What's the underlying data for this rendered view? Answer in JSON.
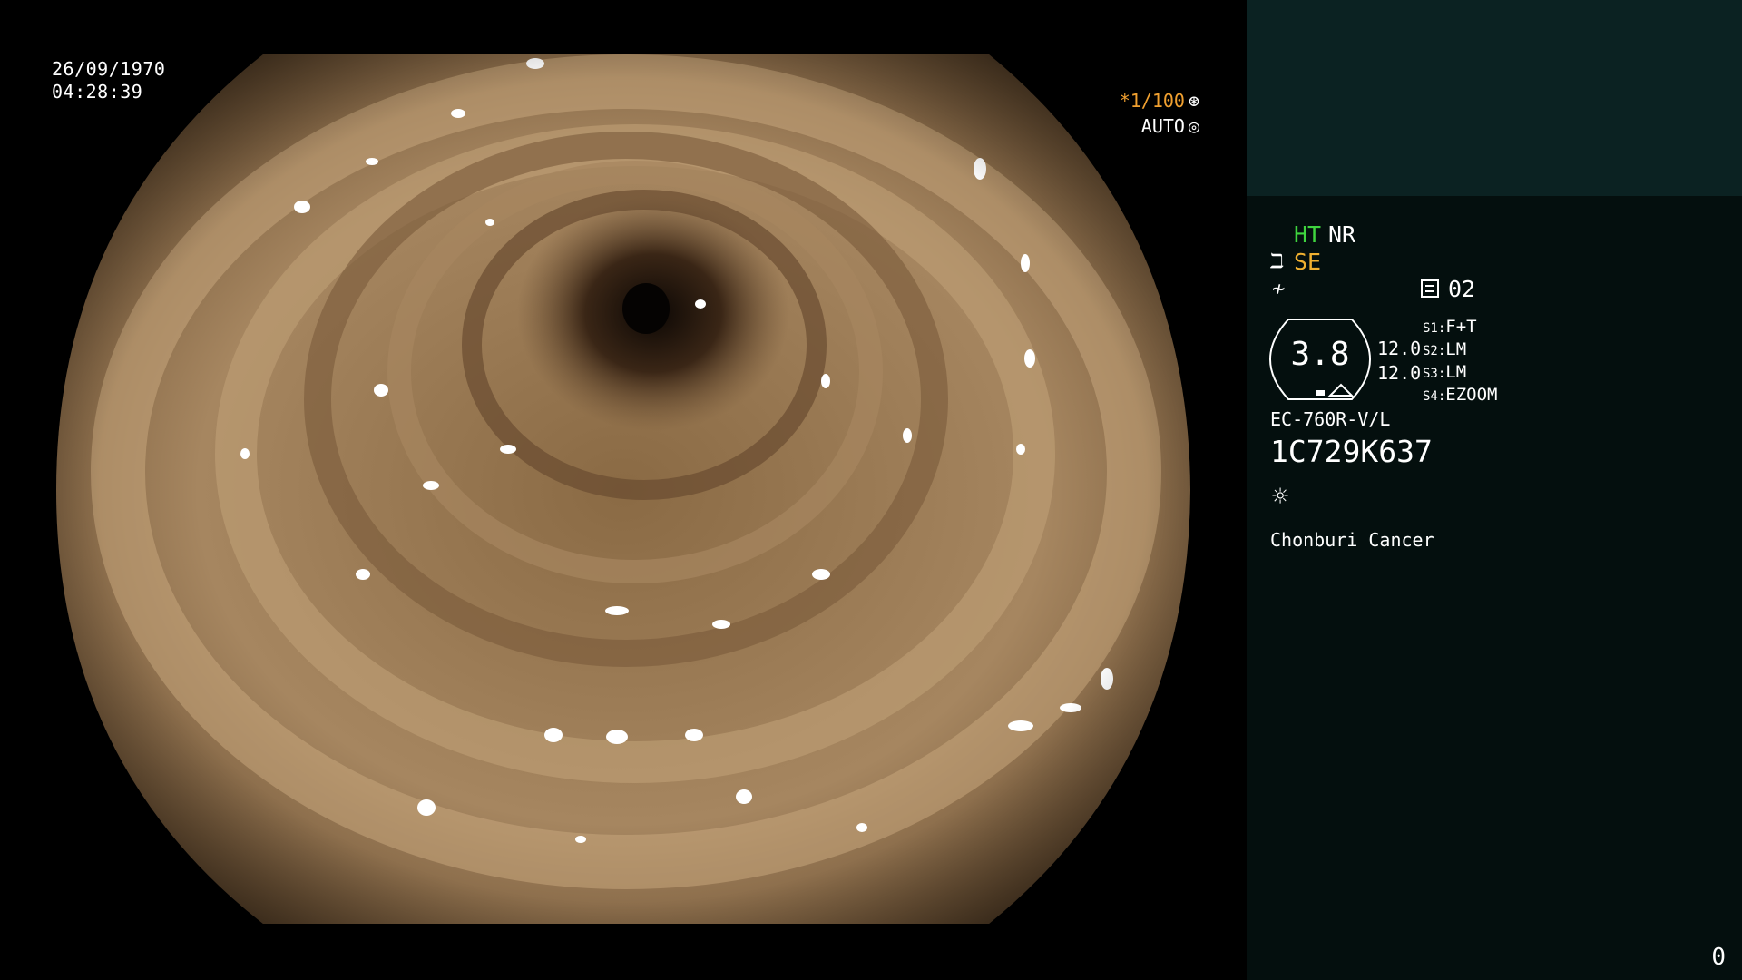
{
  "overlay": {
    "date": "26/09/1970",
    "time": "04:28:39",
    "shutter": "*1/100",
    "shutter_icon": "⊛",
    "iris_mode": "AUTO",
    "iris_icon": "◎"
  },
  "panel": {
    "mode_ht": "HT",
    "mode_nr": "NR",
    "se_icon": "ℶ",
    "mode_se": "SE",
    "wave_icon": "≁",
    "memo_number": "02",
    "zoom_value": "3.8",
    "zoom_values": [
      "12.0",
      "12.0"
    ],
    "switches": [
      {
        "key": "S1:",
        "value": "F+T"
      },
      {
        "key": "S2:",
        "value": "LM"
      },
      {
        "key": "S3:",
        "value": "LM"
      },
      {
        "key": "S4:",
        "value": "EZOOM"
      }
    ],
    "scope_model": "EC-760R-V/L",
    "serial_number": "1C729K637",
    "light_icon": "☼",
    "institution": "Chonburi Cancer",
    "frame_counter": "0"
  },
  "colors": {
    "ht_green": "#3fd43f",
    "se_orange": "#f0b030",
    "shutter_orange": "#f0a030",
    "panel_bg": "#040f0e",
    "panel_top_bg": "#0b2222"
  }
}
